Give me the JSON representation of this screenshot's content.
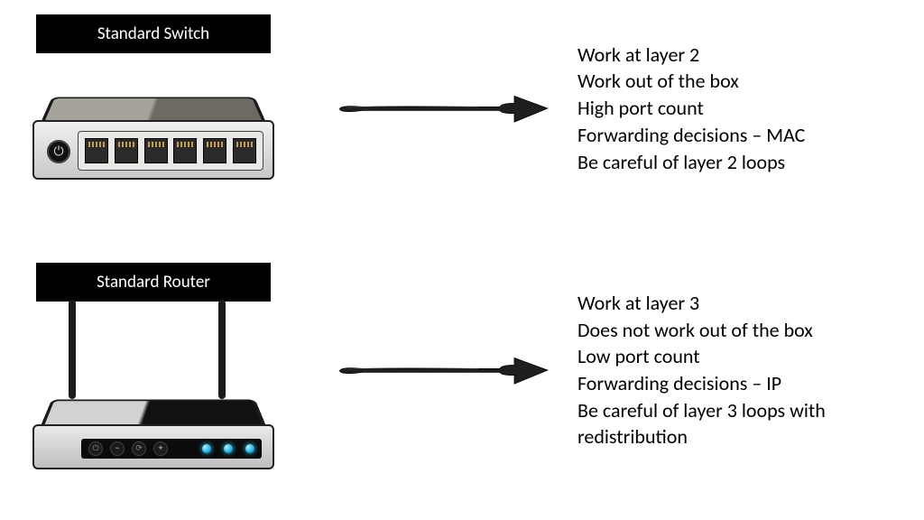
{
  "switch": {
    "label": "Standard Switch",
    "bullets": [
      "Work at layer 2",
      "Work out of the box",
      "High port count",
      "Forwarding decisions – MAC",
      "Be careful of layer 2 loops"
    ]
  },
  "router": {
    "label": "Standard Router",
    "bullets": [
      "Work at layer 3",
      "Does not work out of the box",
      "Low port count",
      "Forwarding decisions – IP",
      "Be careful of layer 3 loops with redistribution"
    ]
  }
}
